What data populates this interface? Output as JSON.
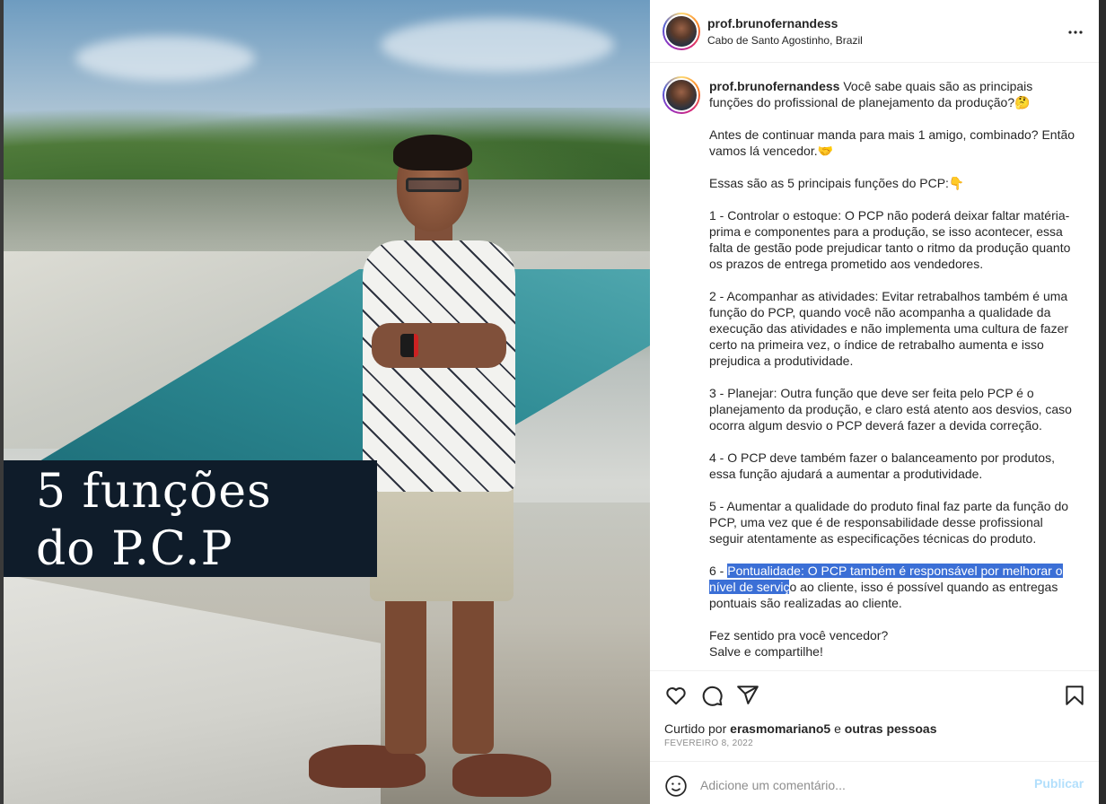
{
  "post": {
    "title_line1": "5 funções",
    "title_line2": "do P.C.P"
  },
  "header": {
    "username": "prof.brunofernandess",
    "location": "Cabo de Santo Agostinho, Brazil",
    "more_icon": "more-horizontal-icon"
  },
  "caption": {
    "username": "prof.brunofernandess",
    "p1": " Você sabe quais são as principais funções do profissional de planejamento da produção?🤔",
    "p2": "Antes de continuar manda para mais 1 amigo, combinado? Então vamos lá vencedor.🤝",
    "p3": "Essas são as 5 principais funções do PCP:👇",
    "p4": "1 - Controlar o estoque: O PCP não poderá deixar faltar matéria-prima e componentes para a produção, se isso acontecer, essa falta de gestão pode prejudicar tanto o ritmo da produção quanto os prazos de entrega prometido aos vendedores.",
    "p5": "2 - Acompanhar as atividades: Evitar retrabalhos também é uma função do PCP, quando você não acompanha a qualidade da execução das atividades e não implementa uma cultura de fazer certo na primeira vez, o índice de retrabalho aumenta e isso prejudica a produtividade.",
    "p6": "3 - Planejar: Outra função que deve ser feita pelo PCP é o planejamento da produção, e claro está atento aos desvios, caso ocorra algum desvio o PCP deverá fazer a devida correção.",
    "p7": "4 - O PCP deve também fazer o balanceamento por produtos, essa função ajudará a aumentar a produtividade.",
    "p8": "5 - Aumentar a qualidade do produto final faz parte da função do PCP, uma vez que é de responsabilidade desse profissional seguir atentamente as especificações técnicas do produto.",
    "p9_prefix": "6 - ",
    "p9_selected": "Pontualidade: O PCP também é responsável por melhorar o nível de serviç",
    "p9_rest": "o ao cliente, isso é possível quando as entregas pontuais são realizadas ao cliente.",
    "p10_line1": "Fez sentido pra você vencedor?",
    "p10_line2": "Salve e compartilhe!"
  },
  "actions": {
    "icons": [
      "heart-icon",
      "comment-icon",
      "share-icon",
      "bookmark-icon"
    ],
    "likes_prefix": "Curtido por ",
    "likes_user": "erasmomariano5",
    "likes_mid": " e ",
    "likes_others": "outras pessoas",
    "date": "FEVEREIRO 8, 2022"
  },
  "comment": {
    "placeholder": "Adicione um comentário...",
    "value": "",
    "publish_label": "Publicar",
    "emoji_icon": "emoji-icon"
  },
  "colors": {
    "title_box": "#0f1c2a",
    "publish": "#b2dffc",
    "selection": "#3b6fd6",
    "text": "#262626",
    "muted": "#8e8e8e"
  }
}
